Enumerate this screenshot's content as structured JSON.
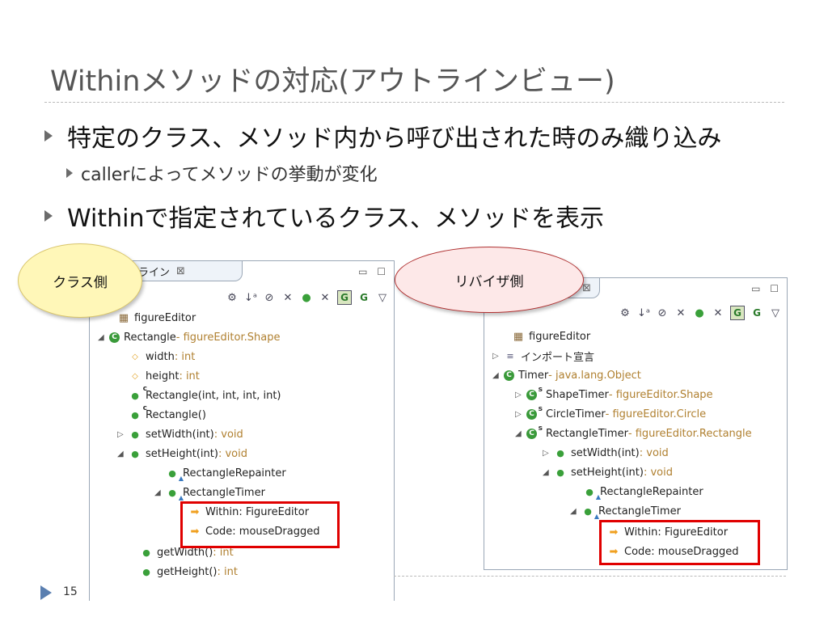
{
  "slide": {
    "title": "Withinメソッドの対応(アウトラインビュー)",
    "bullets": [
      {
        "text": "特定のクラス、メソッド内から呼び出された時のみ織り込み",
        "sub": "callerによってメソッドの挙動が変化"
      },
      {
        "text": "Withinで指定されているクラス、メソッドを表示"
      }
    ],
    "page_number": "15"
  },
  "bubbles": {
    "class_side": "クラス側",
    "reviser_side": "リバイザ側"
  },
  "left_panel": {
    "tab_label": "ライン",
    "tab_close": "⊠",
    "window_controls": "▭ ☐",
    "tree": [
      {
        "name": "figureEditor",
        "detail": ""
      },
      {
        "name": "Rectangle",
        "detail": " - figureEditor.Shape"
      },
      {
        "name": "width",
        "detail": " : int"
      },
      {
        "name": "height",
        "detail": " : int"
      },
      {
        "name": "Rectangle(int, int, int, int)",
        "detail": ""
      },
      {
        "name": "Rectangle()",
        "detail": ""
      },
      {
        "name": "setWidth(int)",
        "detail": " : void"
      },
      {
        "name": "setHeight(int)",
        "detail": " : void"
      },
      {
        "name": "RectangleRepainter",
        "detail": ""
      },
      {
        "name": "RectangleTimer",
        "detail": ""
      },
      {
        "name": "Within: FigureEditor",
        "detail": ""
      },
      {
        "name": "Code: mouseDragged",
        "detail": ""
      },
      {
        "name": "getWidth()",
        "detail": " : int"
      },
      {
        "name": "getHeight()",
        "detail": " : int"
      }
    ]
  },
  "right_panel": {
    "tab_close": "⊠",
    "window_controls": "▭ ☐",
    "tree": [
      {
        "name": "figureEditor",
        "detail": ""
      },
      {
        "name": "インポート宣言",
        "detail": ""
      },
      {
        "name": "Timer",
        "detail": " - java.lang.Object"
      },
      {
        "name": "ShapeTimer",
        "detail": " - figureEditor.Shape"
      },
      {
        "name": "CircleTimer",
        "detail": " - figureEditor.Circle"
      },
      {
        "name": "RectangleTimer",
        "detail": " - figureEditor.Rectangle"
      },
      {
        "name": "setWidth(int)",
        "detail": " : void"
      },
      {
        "name": "setHeight(int)",
        "detail": " : void"
      },
      {
        "name": "RectangleRepainter",
        "detail": ""
      },
      {
        "name": "RectangleTimer",
        "detail": ""
      },
      {
        "name": "Within: FigureEditor",
        "detail": ""
      },
      {
        "name": "Code: mouseDragged",
        "detail": ""
      }
    ]
  },
  "icons": {
    "package": "package-icon",
    "class": "class-icon",
    "field": "field-icon",
    "method": "method-icon",
    "import": "import-icon",
    "advice": "advice-arrow-icon"
  },
  "colors": {
    "highlight_box": "#e00000",
    "class_bubble": "#fff7b8",
    "reviser_bubble": "#fde8e8",
    "detail_text": "#b08030"
  }
}
